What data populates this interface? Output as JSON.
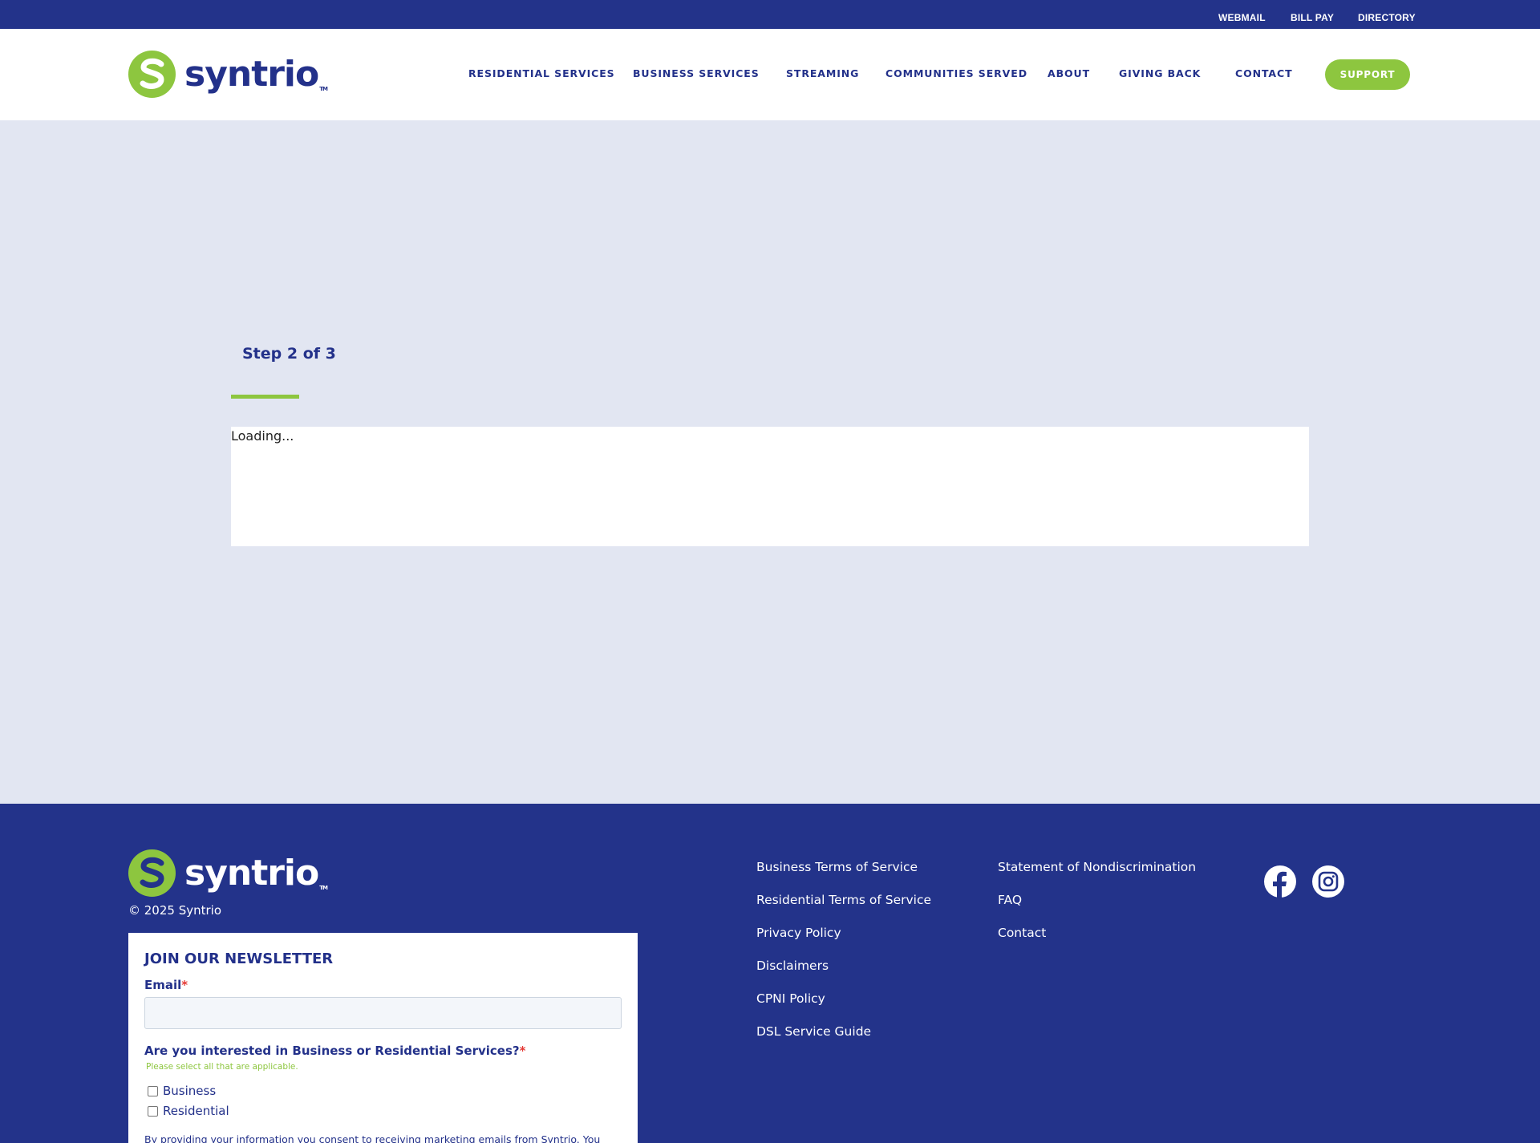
{
  "utility_bar": {
    "links": [
      "WEBMAIL",
      "BILL PAY",
      "DIRECTORY"
    ]
  },
  "brand": {
    "name": "syntrio",
    "tm": "TM",
    "colors": {
      "navy": "#23338a",
      "green": "#8dc63f",
      "page_bg": "#e2e6f2"
    }
  },
  "nav": {
    "items": [
      "RESIDENTIAL SERVICES",
      "BUSINESS SERVICES",
      "STREAMING",
      "COMMUNITIES SERVED",
      "ABOUT",
      "GIVING BACK",
      "CONTACT"
    ],
    "support_label": "SUPPORT"
  },
  "main": {
    "step_label": "Step 2 of 3",
    "loading_text": "Loading..."
  },
  "footer": {
    "copyright": "© 2025 Syntrio",
    "links_col1": [
      "Business Terms of Service",
      "Residential Terms of Service",
      "Privacy Policy",
      "Disclaimers",
      "CPNI Policy",
      "DSL Service Guide"
    ],
    "links_col2": [
      "Statement of Nondiscrimination",
      "FAQ",
      "Contact"
    ],
    "social_icons": [
      "facebook-icon",
      "instagram-icon"
    ]
  },
  "newsletter": {
    "title": "JOIN OUR NEWSLETTER",
    "email_label": "Email",
    "required_mark": "*",
    "services_label": "Are you interested in Business or Residential Services?",
    "hint": "Please select all that are applicable.",
    "options": [
      "Business",
      "Residential"
    ],
    "consent": "By providing your information you consent to receiving marketing emails from Syntrio. You"
  }
}
